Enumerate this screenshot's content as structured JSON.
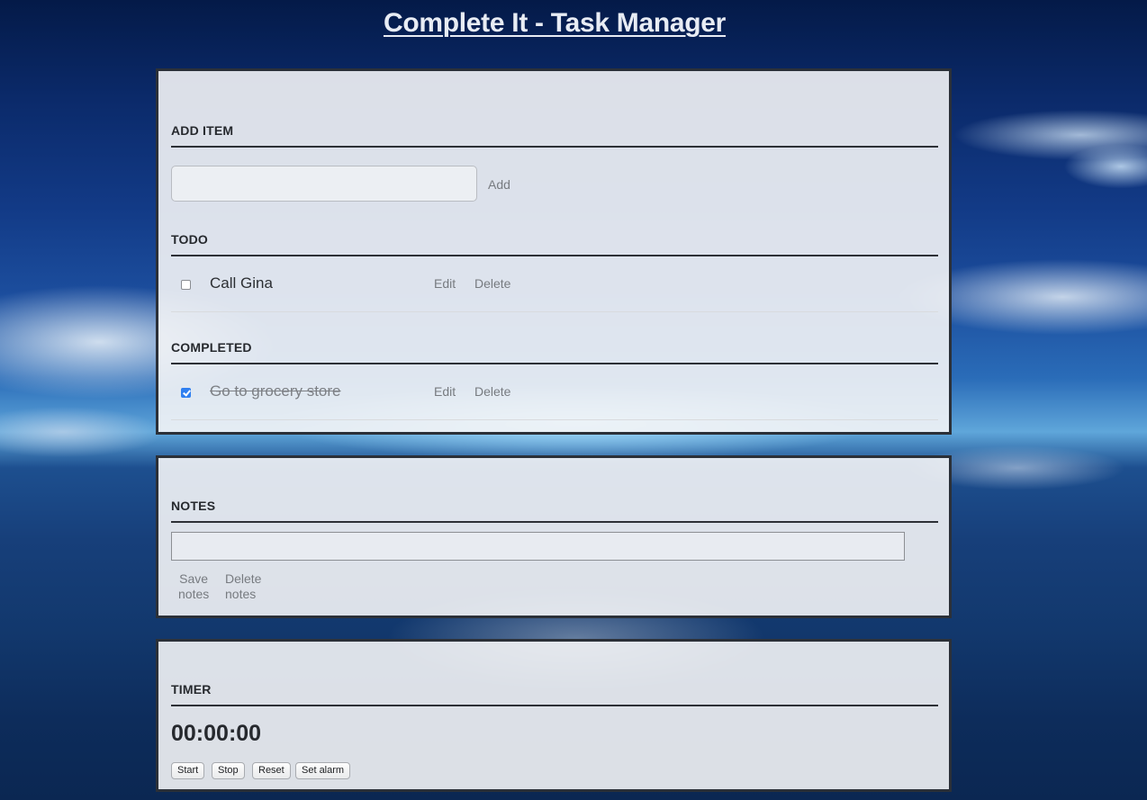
{
  "app": {
    "title": "Complete It - Task Manager"
  },
  "add_item": {
    "heading": "ADD ITEM",
    "input_value": "",
    "add_label": "Add"
  },
  "todo": {
    "heading": "TODO",
    "items": [
      {
        "text": "Call Gina",
        "checked": false,
        "edit_label": "Edit",
        "delete_label": "Delete"
      }
    ]
  },
  "completed": {
    "heading": "COMPLETED",
    "items": [
      {
        "text": "Go to grocery store",
        "checked": true,
        "edit_label": "Edit",
        "delete_label": "Delete"
      }
    ]
  },
  "notes": {
    "heading": "NOTES",
    "input_value": "",
    "save_label_line1": "Save",
    "save_label_line2": "notes",
    "delete_label_line1": "Delete",
    "delete_label_line2": "notes"
  },
  "timer": {
    "heading": "TIMER",
    "display": "00:00:00",
    "buttons": {
      "start": "Start",
      "stop": "Stop",
      "reset": "Reset",
      "alarm": "Set alarm"
    }
  },
  "colors": {
    "accent_checkbox": "#2f7ff0",
    "panel_border": "#2b3038",
    "title_text": "#e8ecf4"
  }
}
